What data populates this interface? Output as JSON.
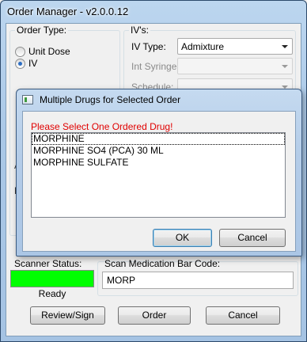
{
  "window": {
    "title": "Order Manager - v2.0.0.12"
  },
  "order_type": {
    "group_label": "Order Type:",
    "options": [
      {
        "label": "Unit Dose",
        "selected": false
      },
      {
        "label": "IV",
        "selected": true
      }
    ]
  },
  "ivs": {
    "group_label": "IV's:",
    "iv_type_label": "IV Type:",
    "iv_type_value": "Admixture",
    "int_syringe_label": "Int Syringe:",
    "int_syringe_value": "",
    "schedule_label": "Schedule:",
    "schedule_value": ""
  },
  "scanner": {
    "label": "Scanner Status:",
    "status_text": "Ready",
    "status_color": "#00ff00"
  },
  "barcode": {
    "label": "Scan Medication Bar Code:",
    "value": "MORP"
  },
  "buttons": {
    "review_sign": "Review/Sign",
    "order": "Order",
    "cancel": "Cancel"
  },
  "dialog": {
    "title": "Multiple Drugs for Selected Order",
    "prompt": "Please Select One Ordered Drug!",
    "prompt_color": "#e00000",
    "drugs": [
      "MORPHINE",
      "MORPHINE SO4 (PCA) 30 ML",
      "MORPHINE SULFATE"
    ],
    "selected_index": 0,
    "ok_label": "OK",
    "cancel_label": "Cancel"
  }
}
